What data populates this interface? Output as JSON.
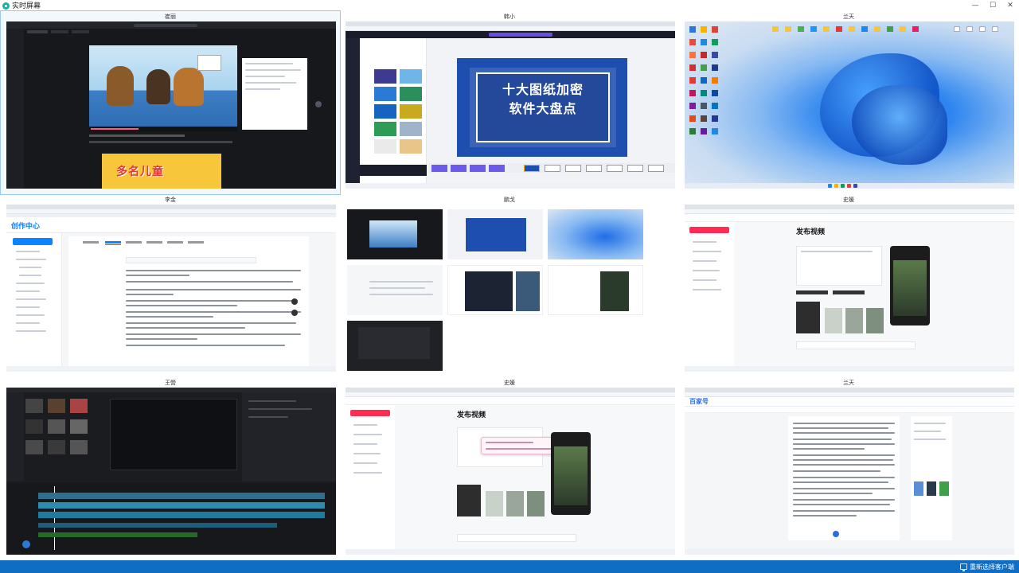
{
  "app": {
    "title": "实时屏幕",
    "controls": [
      "—",
      "☐",
      "✕"
    ]
  },
  "tiles": [
    {
      "name": "崔丽",
      "selected": true,
      "screen": "video-player"
    },
    {
      "name": "韩小",
      "selected": false,
      "screen": "slide-editor"
    },
    {
      "name": "兰天",
      "selected": false,
      "screen": "desktop"
    },
    {
      "name": "李金",
      "selected": false,
      "screen": "article-editor"
    },
    {
      "name": "鹏戈",
      "selected": false,
      "screen": "multi-screen"
    },
    {
      "name": "史媛",
      "selected": false,
      "screen": "video-publish"
    },
    {
      "name": "王營",
      "selected": false,
      "screen": "video-timeline"
    },
    {
      "name": "史媛",
      "selected": false,
      "screen": "video-publish-dialog"
    },
    {
      "name": "兰天",
      "selected": false,
      "screen": "doc-editor"
    }
  ],
  "screens": {
    "slide_title_line1": "十大图纸加密",
    "slide_title_line2": "软件大盘点",
    "cartoon_banner": "多名儿童",
    "creator_brand": "创作中心",
    "publish_heading": "发布视频",
    "doc_brand": "百家号"
  },
  "colors": {
    "accent": "#0f6dc4",
    "slide_blue": "#1e4fb0",
    "chrome_gray": "#dfe3ea",
    "win11_blue": "#1560d8",
    "creator_red": "#fe2c55"
  },
  "bottom": {
    "reselect_label": "重新选择客户端",
    "reselect_icon": "monitor-icon"
  }
}
